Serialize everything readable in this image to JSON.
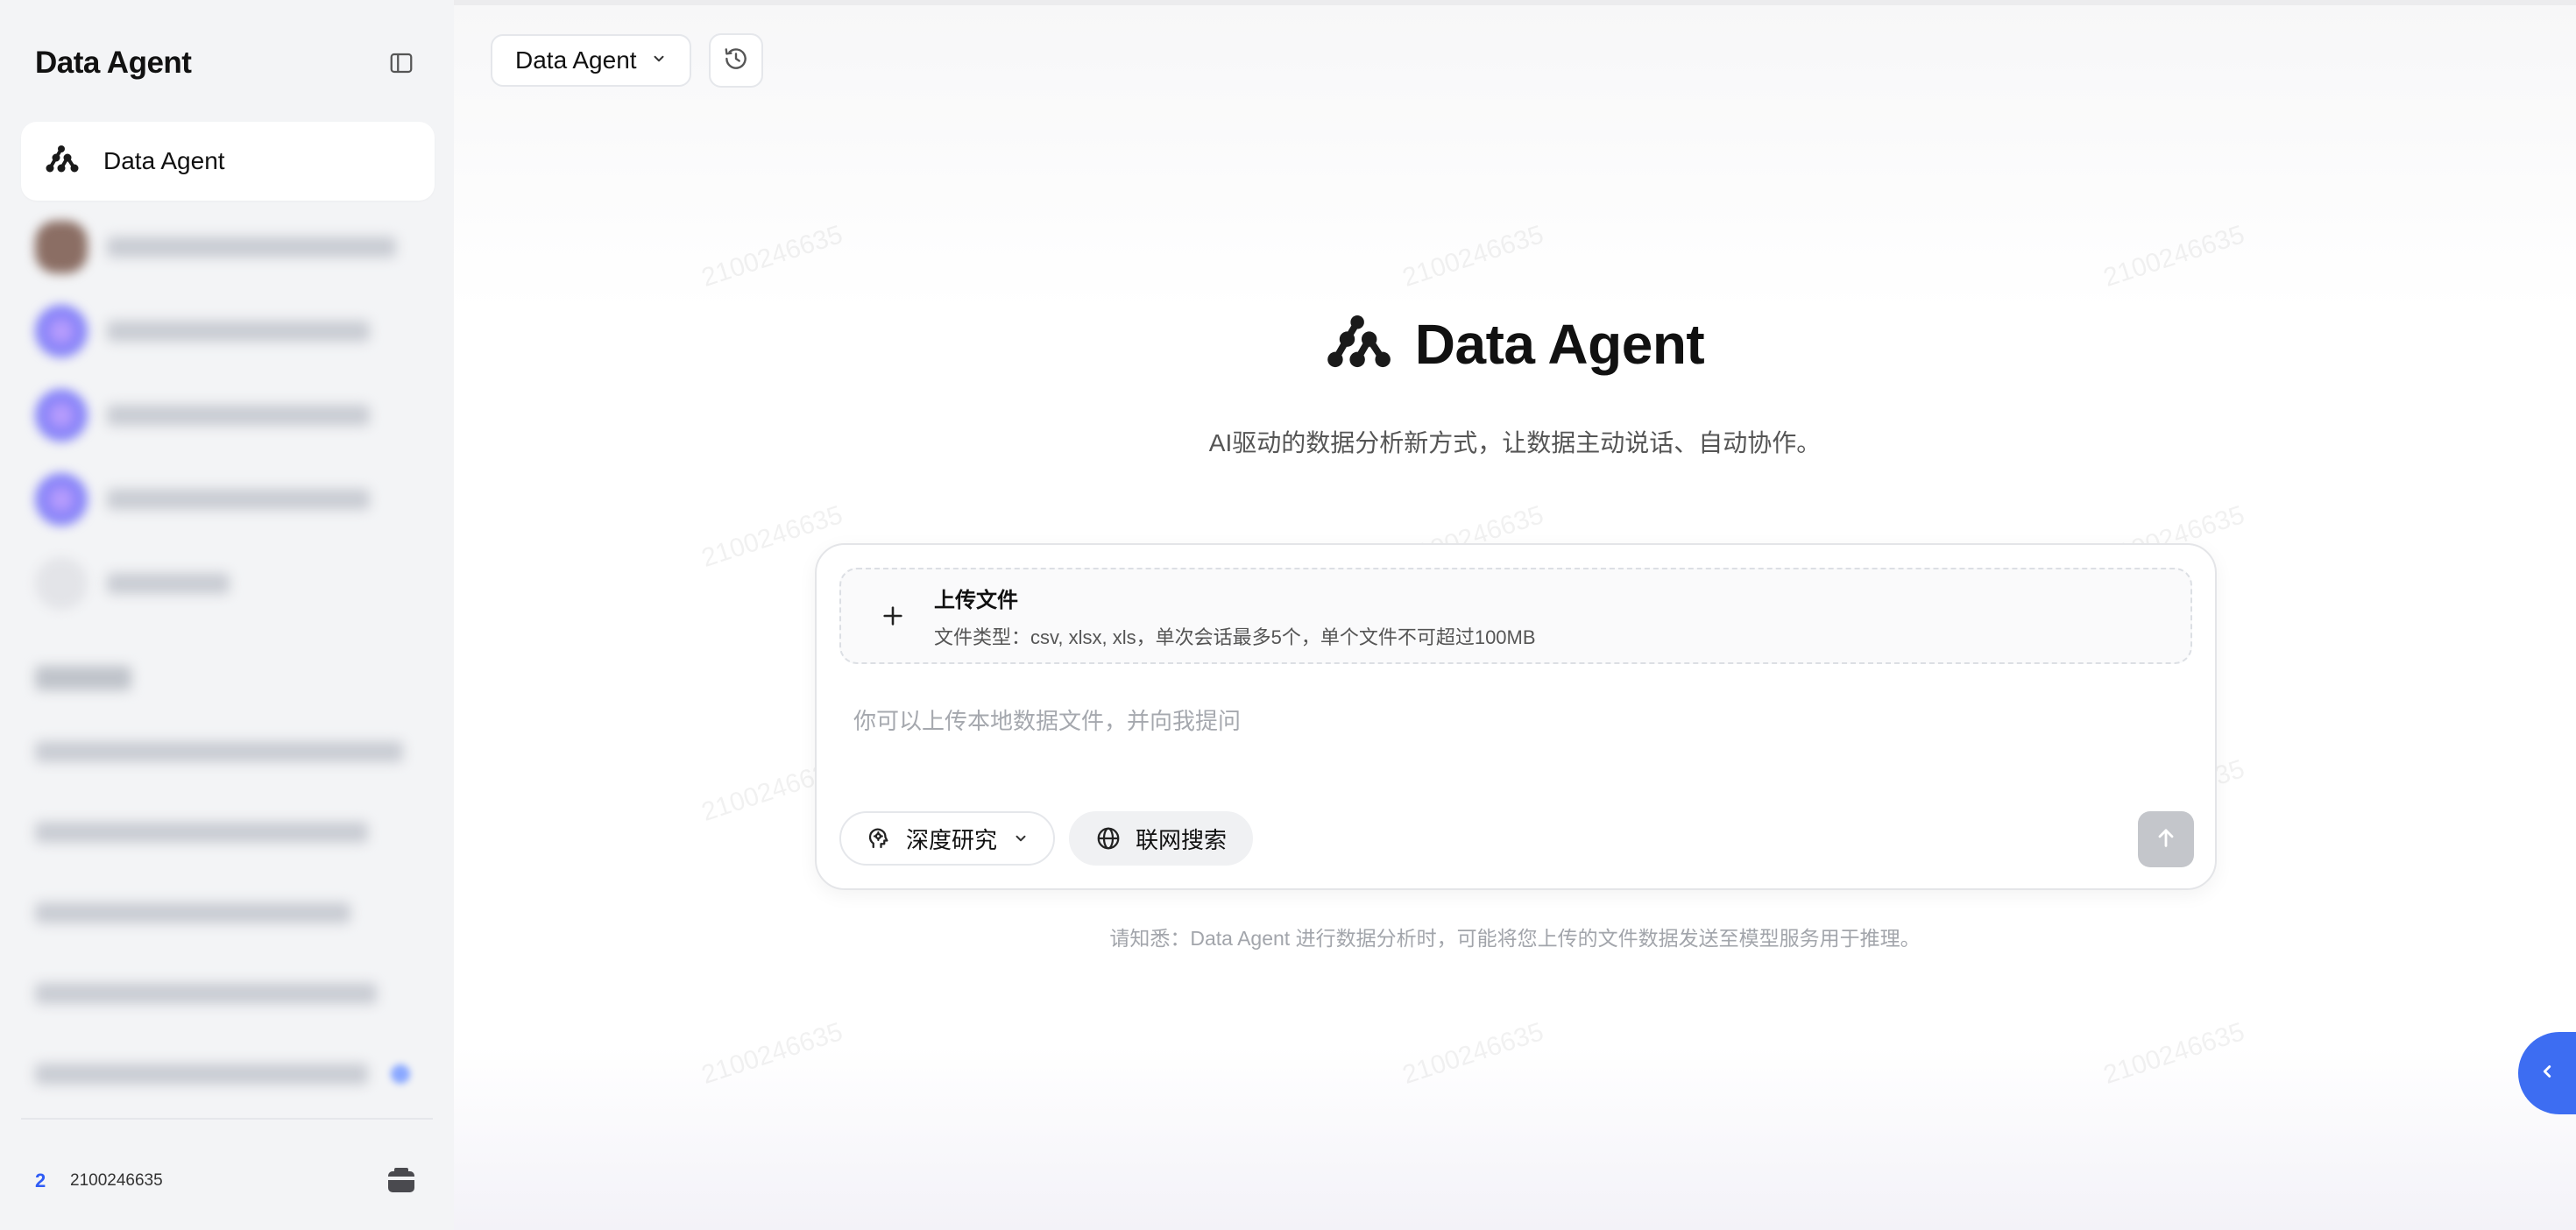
{
  "sidebar": {
    "brand": "Data Agent",
    "active_item": {
      "label": "Data Agent"
    },
    "user": {
      "level": "2",
      "id": "2100246635"
    }
  },
  "topbar": {
    "agent_select": "Data Agent"
  },
  "hero": {
    "title": "Data Agent",
    "subtitle": "AI驱动的数据分析新方式，让数据主动说话、自动协作。"
  },
  "composer": {
    "upload_title": "上传文件",
    "upload_desc": "文件类型：csv, xlsx, xls，单次会话最多5个，单个文件不可超过100MB",
    "input_placeholder": "你可以上传本地数据文件，并向我提问",
    "input_value": "",
    "research_label": "深度研究",
    "web_search_label": "联网搜索"
  },
  "disclaimer": "请知悉：Data Agent 进行数据分析时，可能将您上传的文件数据发送至模型服务用于推理。",
  "watermark": "2100246635",
  "colors": {
    "accent": "#3d6df2",
    "user_level": "#2f5cf5",
    "send_disabled": "#c4c6cb"
  },
  "icons": {
    "brand_logo": "data-agent-logo-icon",
    "collapse": "sidebar-collapse-icon",
    "history": "history-icon",
    "upload": "plus-icon",
    "research": "brain-icon",
    "web": "globe-icon",
    "send": "arrow-up-icon",
    "wallet": "wallet-icon",
    "float": "chevron-left-icon"
  }
}
